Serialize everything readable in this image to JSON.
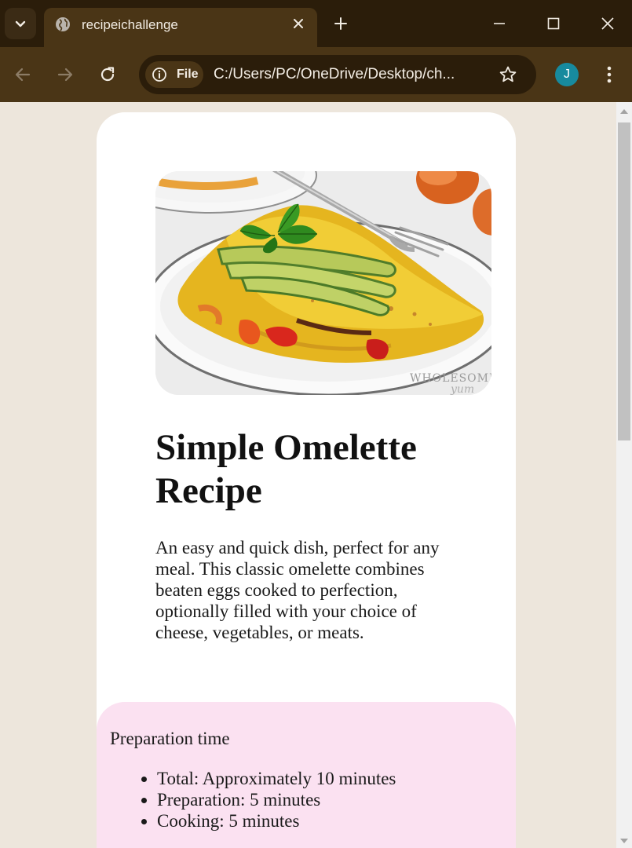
{
  "browser": {
    "tab_title": "recipeichallenge",
    "site_chip_label": "File",
    "url": "C:/Users/PC/OneDrive/Desktop/ch...",
    "profile_initial": "J",
    "accent": "#178a9e"
  },
  "recipe": {
    "title": "Simple Omelette Recipe",
    "description": "An easy and quick dish, perfect for any meal. This classic omelette combines beaten eggs cooked to perfection, optionally filled with your choice of cheese, vegetables, or meats.",
    "photo_watermark": "WHOLESOME yum",
    "preparation": {
      "heading": "Preparation time",
      "items": [
        "Total: Approximately 10 minutes",
        "Preparation: 5 minutes",
        "Cooking: 5 minutes"
      ],
      "background": "#fbe1f1"
    }
  },
  "icons": {
    "tab_search": "chevron-down-icon",
    "tab_favicon": "globe-icon",
    "tab_close": "close-icon",
    "new_tab": "plus-icon",
    "minimize": "minimize-icon",
    "maximize": "maximize-icon",
    "close_window": "close-icon",
    "back": "arrow-left-icon",
    "forward": "arrow-right-icon",
    "reload": "reload-icon",
    "site_info": "info-icon",
    "bookmark": "star-icon",
    "menu": "kebab-menu-icon"
  }
}
